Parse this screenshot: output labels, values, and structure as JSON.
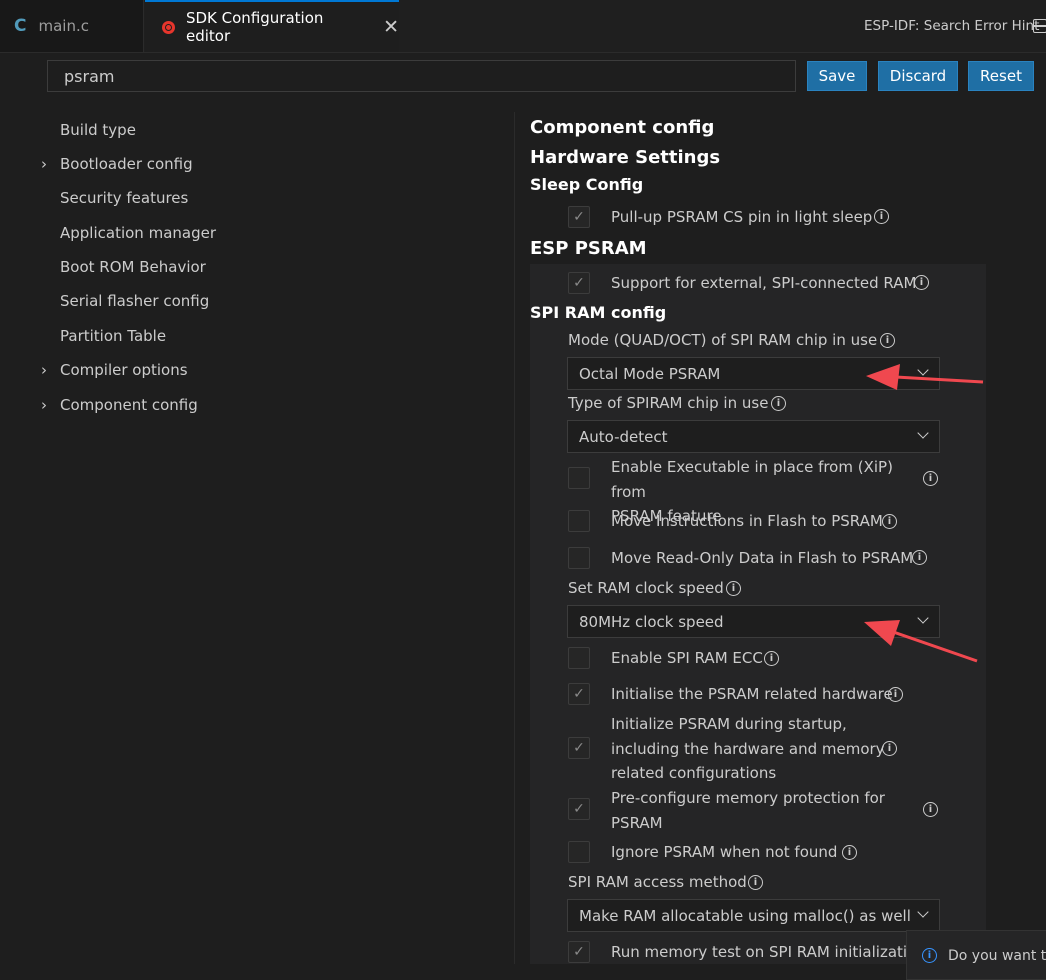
{
  "tabs": {
    "main_c": {
      "icon": "c-language-icon",
      "icon_text": "C",
      "label": "main.c"
    },
    "sdk_config": {
      "icon": "espressif-icon",
      "label": "SDK Configuration editor",
      "close": "✕"
    },
    "hint": "ESP-IDF: Search Error Hint",
    "split_icon": "split-editor-icon"
  },
  "search": {
    "value": "psram"
  },
  "buttons": {
    "save": "Save",
    "discard": "Discard",
    "reset": "Reset"
  },
  "sidebar": {
    "items": [
      {
        "label": "Build type",
        "expandable": false
      },
      {
        "label": "Bootloader config",
        "expandable": true
      },
      {
        "label": "Security features",
        "expandable": false
      },
      {
        "label": "Application manager",
        "expandable": false
      },
      {
        "label": "Boot ROM Behavior",
        "expandable": false
      },
      {
        "label": "Serial flasher config",
        "expandable": false
      },
      {
        "label": "Partition Table",
        "expandable": false
      },
      {
        "label": "Compiler options",
        "expandable": true
      },
      {
        "label": "Component config",
        "expandable": true
      }
    ],
    "chevron": "›"
  },
  "config": {
    "heading_component": "Component config",
    "heading_hardware": "Hardware Settings",
    "heading_sleep": "Sleep Config",
    "heading_esp_psram": "ESP PSRAM",
    "heading_spi_ram": "SPI RAM config",
    "info_glyph": "i",
    "check_glyph": "✓",
    "opt_pullup": {
      "label": "Pull-up PSRAM CS pin in light sleep",
      "checked": true
    },
    "opt_support": {
      "label": "Support for external, SPI-connected RAM",
      "checked": true
    },
    "mode": {
      "label": "Mode (QUAD/OCT) of SPI RAM chip in use",
      "value": "Octal Mode PSRAM"
    },
    "type": {
      "label": "Type of SPIRAM chip in use",
      "value": "Auto-detect"
    },
    "opt_xip": {
      "label_line1": "Enable Executable in place from (XiP) from",
      "label_line2": "PSRAM feature",
      "checked": false
    },
    "opt_move_instr": {
      "label": "Move Instructions in Flash to PSRAM",
      "checked": false
    },
    "opt_move_ro": {
      "label": "Move Read-Only Data in Flash to PSRAM",
      "checked": false
    },
    "clock": {
      "label": "Set RAM clock speed",
      "value": "80MHz clock speed"
    },
    "opt_ecc": {
      "label": "Enable SPI RAM ECC",
      "checked": false
    },
    "opt_init_hw": {
      "label": "Initialise the PSRAM related hardware",
      "checked": true
    },
    "opt_init_startup": {
      "label_line1": "Initialize PSRAM during startup,",
      "label_line2": "including the hardware and memory",
      "label_line3": "related configurations",
      "checked": true
    },
    "opt_preconfig": {
      "label_line1": "Pre-configure memory protection for",
      "label_line2": "PSRAM",
      "checked": true
    },
    "opt_ignore": {
      "label": "Ignore PSRAM when not found",
      "checked": false
    },
    "access": {
      "label": "SPI RAM access method",
      "value": "Make RAM allocatable using malloc() as well"
    },
    "opt_memtest": {
      "label": "Run memory test on SPI RAM initialization",
      "checked": true
    }
  },
  "toast": {
    "text": "Do you want to"
  },
  "annotation_color": "#f0484f"
}
